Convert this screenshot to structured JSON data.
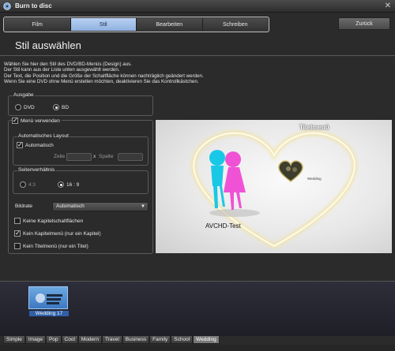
{
  "window": {
    "title": "Burn to disc",
    "close_glyph": "✕"
  },
  "steps": [
    {
      "label": "Film",
      "active": false
    },
    {
      "label": "Stil",
      "active": true
    },
    {
      "label": "Bearbeiten",
      "active": false
    },
    {
      "label": "Schreiben",
      "active": false
    }
  ],
  "back_label": "Zurück",
  "heading": "Stil auswählen",
  "description": [
    "Wählen Sie hier den Stil des DVD/BD-Menüs (Design) aus.",
    "Der Stil kann aus der Liste unten ausgewählt werden.",
    "Der Text, die Position und die Größe der Schaltfläche können nachträglich geändert werden.",
    "Wenn Sie eine DVD ohne Menü erstellen möchten, deaktivieren Sie das Kontrollkästchen."
  ],
  "output": {
    "label": "Ausgabe",
    "dvd": "DVD",
    "bd": "BD",
    "selected": "BD"
  },
  "menu": {
    "use_label": "Menü verwenden",
    "use_checked": true,
    "auto_layout": {
      "label": "Automatisches Layout",
      "auto_label": "Automatisch",
      "auto_checked": true,
      "row_label": "Zeile",
      "x_label": "x",
      "col_label": "Spalte"
    },
    "aspect": {
      "label": "Seitenverhältnis",
      "opt1": "4:3",
      "opt2": "16 : 9",
      "selected": "16 : 9"
    },
    "framerate_label": "Bildrate",
    "framerate_value": "Automatisch",
    "checks": [
      {
        "label": "Keine Kapitelschaltflächen",
        "checked": false
      },
      {
        "label": "Kein Kapitelmenü (nur ein Kapitel)",
        "checked": true
      },
      {
        "label": "Kein Titelmenü (nur ein Titel)",
        "checked": false
      }
    ]
  },
  "preview": {
    "menu_title": "Titelmenü",
    "disc_title": "AVCHD-Test",
    "thumb_caption": "Wedding"
  },
  "theme": {
    "name": "Wedding 17"
  },
  "tabs": [
    "Simple",
    "Image",
    "Pop",
    "Cool",
    "Modern",
    "Travel",
    "Business",
    "Family",
    "School",
    "Wedding"
  ],
  "active_tab": "Wedding",
  "colors": {
    "accent": "#8fb1e0",
    "background": "#2b2b2b",
    "selection": "#2f5fa8"
  }
}
